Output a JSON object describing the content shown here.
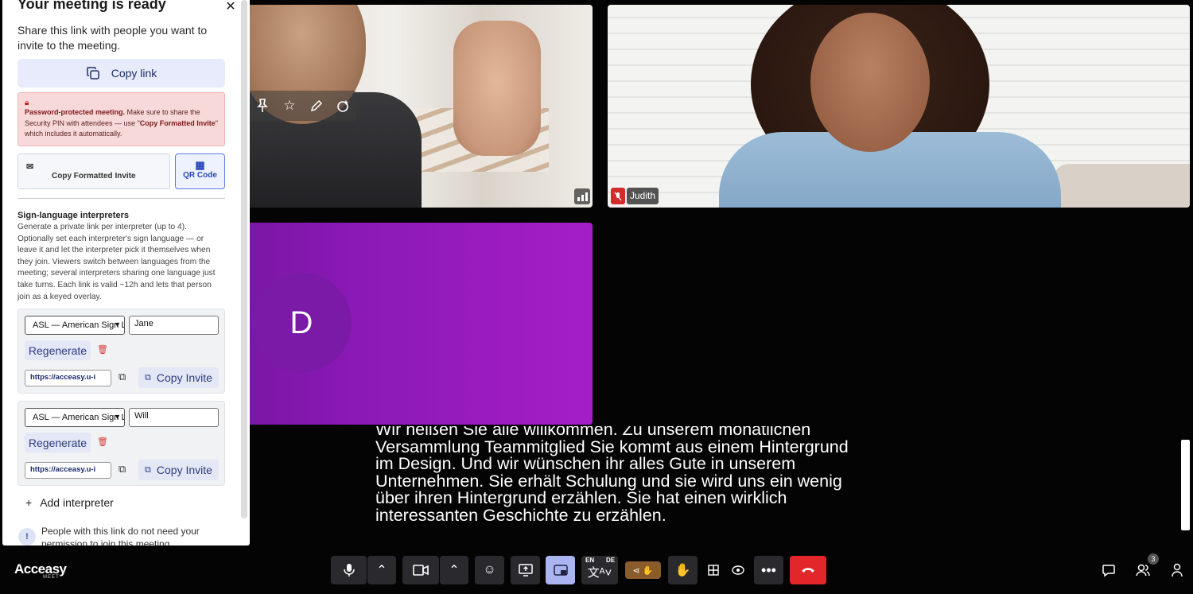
{
  "panel": {
    "title": "Your meeting is ready",
    "intro": "Share this link with people you want to invite to the meeting.",
    "copy_link_label": "Copy link",
    "warning": {
      "lead": "Password-protected meeting.",
      "text_1": " Make sure to share the Security PIN with attendees — use \"",
      "emph": "Copy Formatted Invite",
      "text_2": "\" which includes it automatically."
    },
    "copy_formatted_label": "Copy Formatted Invite",
    "qr_label": "QR Code",
    "sign_heading": "Sign-language interpreters",
    "sign_description": "Generate a private link per interpreter (up to 4). Optionally set each interpreter's sign language — or leave it and let the interpreter pick it themselves when they join. Viewers switch between languages from the meeting; several interpreters sharing one language just take turns. Each link is valid ~12h and lets that person join as a keyed overlay.",
    "interpreters": [
      {
        "language": "ASL — American Sign Language",
        "name": "Jane",
        "regenerate": "Regenerate",
        "url": "https://acceasy.u-i",
        "copy_invite": "Copy Invite"
      },
      {
        "language": "ASL — American Sign Language",
        "name": "Will",
        "regenerate": "Regenerate",
        "url": "https://acceasy.u-i",
        "copy_invite": "Copy Invite"
      }
    ],
    "add_interpreter": "Add interpreter",
    "permission_note": "People with this link do not need your permission to join this meeting."
  },
  "participants": {
    "judith_name": "Judith",
    "avatar_initial": "D"
  },
  "captions": "Wir heißen Sie alle willkommen. Zu unserem monatlichen Versammlung Teammitglied Sie kommt aus einem Hintergrund im Design. Und wir wünschen ihr alles Gute in unserem Unternehmen. Sie erhält Schulung und sie wird uns ein wenig über ihren Hintergrund erzählen. Sie hat einen wirklich interessanten Geschichte zu erzählen.",
  "toolbar": {
    "logo": "Acceasy",
    "logo_sub": "MEET",
    "lang_from": "EN",
    "lang_to": "DE",
    "participants_count": "3"
  },
  "colors": {
    "accent": "#a9b4f1",
    "hangup": "#e2262a",
    "avatar_bg": "#8a19b5"
  }
}
